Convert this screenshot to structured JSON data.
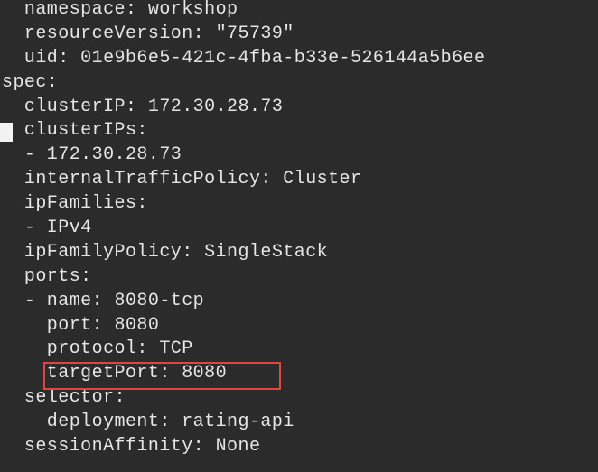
{
  "terminal": {
    "lines": [
      "  namespace: workshop",
      "  resourceVersion: \"75739\"",
      "  uid: 01e9b6e5-421c-4fba-b33e-526144a5b6ee",
      "spec:",
      "  clusterIP: 172.30.28.73",
      "  clusterIPs:",
      "  - 172.30.28.73",
      "  internalTrafficPolicy: Cluster",
      "  ipFamilies:",
      "  - IPv4",
      "  ipFamilyPolicy: SingleStack",
      "  ports:",
      "  - name: 8080-tcp",
      "    port: 8080",
      "    protocol: TCP",
      "    targetPort: 8080",
      "  selector:",
      "    deployment: rating-api",
      "  sessionAffinity: None"
    ]
  },
  "colors": {
    "background": "#2b2b2b",
    "text": "#e6e6e6",
    "cursor": "#f2f2f2",
    "highlight_border": "#e0453f"
  }
}
